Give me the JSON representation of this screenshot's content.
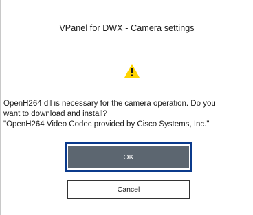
{
  "dialog": {
    "title": "VPanel for DWX - Camera settings",
    "icon": "warning-icon",
    "message_lines": [
      "OpenH264 dll is necessary for the camera operation. Do you",
      "want to download and install?",
      "\"OpenH264 Video Codec provided by Cisco Systems, Inc.\""
    ],
    "ok_label": "OK",
    "cancel_label": "Cancel"
  },
  "colors": {
    "warning_yellow": "#ffd400",
    "ok_button_bg": "#5c6670",
    "focus_border": "#0b3a8c"
  }
}
